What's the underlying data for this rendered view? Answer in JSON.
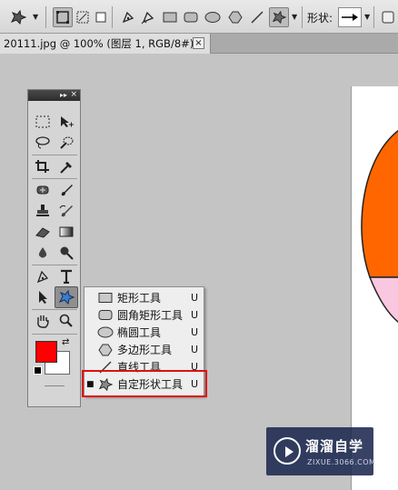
{
  "options_bar": {
    "shape_label": "形状:",
    "tool_icon": "custom-shape-icon"
  },
  "document": {
    "tab_title": "20111.jpg @ 100% (图层 1, RGB/8#) *",
    "close_glyph": "×"
  },
  "toolbox": {
    "collapse_glyph": "▸▸",
    "close_glyph": "×",
    "foreground_color": "#ff0000",
    "background_color": "#ffffff"
  },
  "shape_flyout": {
    "items": [
      {
        "label": "矩形工具",
        "shortcut": "U",
        "icon": "rectangle-icon",
        "selected": false
      },
      {
        "label": "圆角矩形工具",
        "shortcut": "U",
        "icon": "rounded-rectangle-icon",
        "selected": false
      },
      {
        "label": "椭圆工具",
        "shortcut": "U",
        "icon": "ellipse-icon",
        "selected": false
      },
      {
        "label": "多边形工具",
        "shortcut": "U",
        "icon": "polygon-icon",
        "selected": false
      },
      {
        "label": "直线工具",
        "shortcut": "U",
        "icon": "line-icon",
        "selected": false
      },
      {
        "label": "自定形状工具",
        "shortcut": "U",
        "icon": "custom-shape-icon",
        "selected": true
      }
    ],
    "selected_bullet": "■",
    "highlight_color": "#e01010"
  },
  "canvas": {
    "colors": [
      "#ff6600",
      "#f9c8e0",
      "#ffffff"
    ]
  },
  "watermark": {
    "brand": "溜溜自学",
    "url": "ZIXUE.3066.COM"
  }
}
